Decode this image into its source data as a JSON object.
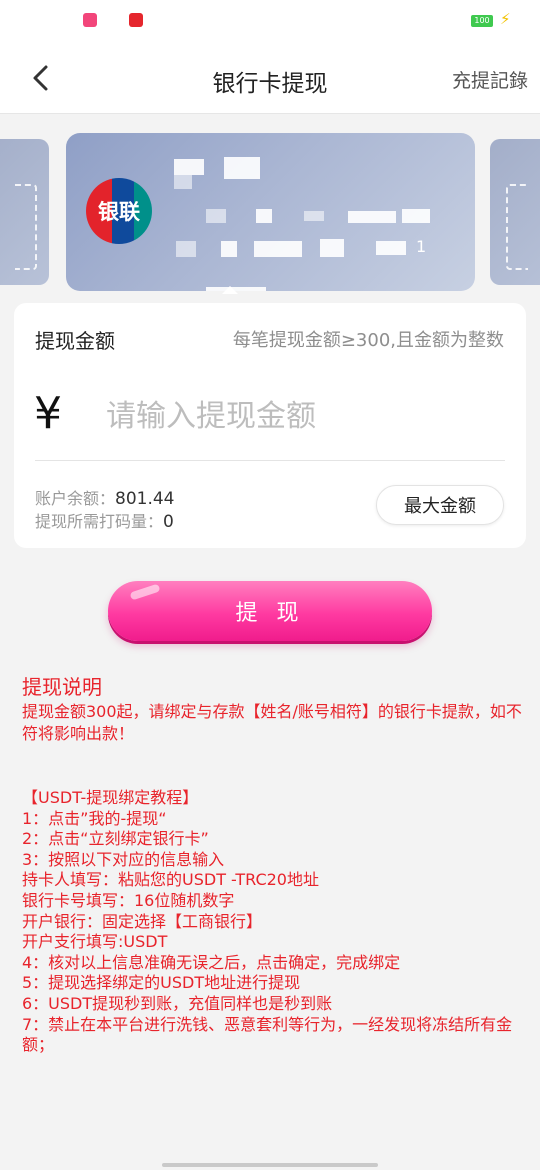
{
  "status_bar": {
    "battery_level": "100",
    "app_icons": [
      "pink-app-icon",
      "red-app-icon"
    ]
  },
  "header": {
    "title": "银行卡提现",
    "records_link": "充提記錄",
    "back_icon": "chevron-left-icon"
  },
  "card": {
    "brand": "银联",
    "number_suffix": "1"
  },
  "amount_panel": {
    "label": "提现金额",
    "rule": "每笔提现金额≥300,且金额为整数",
    "currency_symbol": "¥",
    "input_placeholder": "请输入提现金额",
    "input_value": "",
    "balance_label": "账户余额：",
    "balance_value": "801.44",
    "wager_label": "提现所需打码量：",
    "wager_value": "0",
    "max_button": "最大金额"
  },
  "withdraw_button": "提 现",
  "instructions": {
    "title": "提现说明",
    "body": "提现金额300起，请绑定与存款【姓名/账号相符】的银行卡提款，如不符将影响出款！",
    "tutorial": [
      "【USDT-提现绑定教程】",
      "1：点击”我的-提现“",
      "2：点击“立刻绑定银行卡”",
      "3：按照以下对应的信息输入",
      "持卡人填写：粘贴您的USDT -TRC20地址",
      "银行卡号填写：16位随机数字",
      "开户银行：固定选择【工商银行】",
      "开户支行填写:USDT",
      "4：核对以上信息准确无误之后，点击确定，完成绑定",
      "5：提现选择绑定的USDT地址进行提现",
      "6：USDT提现秒到账，充值同样也是秒到账",
      "7：禁止在本平台进行洗钱、恶意套利等行为，一经发现将冻结所有金额；"
    ]
  },
  "colors": {
    "accent_pink": "#ff3aa1",
    "instruction_red": "#e8242c",
    "card_blue": "#9aa8cc"
  }
}
